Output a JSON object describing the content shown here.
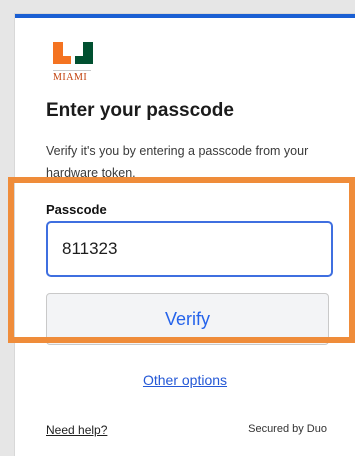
{
  "brand": {
    "logo_text": "MIAMI",
    "logo_orange": "#f47321",
    "logo_green": "#005030",
    "accent_blue": "#1a5fd3",
    "highlight_orange": "#ef8c3a"
  },
  "page": {
    "heading": "Enter your passcode",
    "subtext": "Verify it's you by entering a passcode from your hardware token."
  },
  "form": {
    "passcode_label": "Passcode",
    "passcode_value": "811323",
    "verify_label": "Verify"
  },
  "links": {
    "other_options": "Other options",
    "need_help": "Need help?"
  },
  "footer": {
    "secured_by": "Secured by Duo"
  }
}
